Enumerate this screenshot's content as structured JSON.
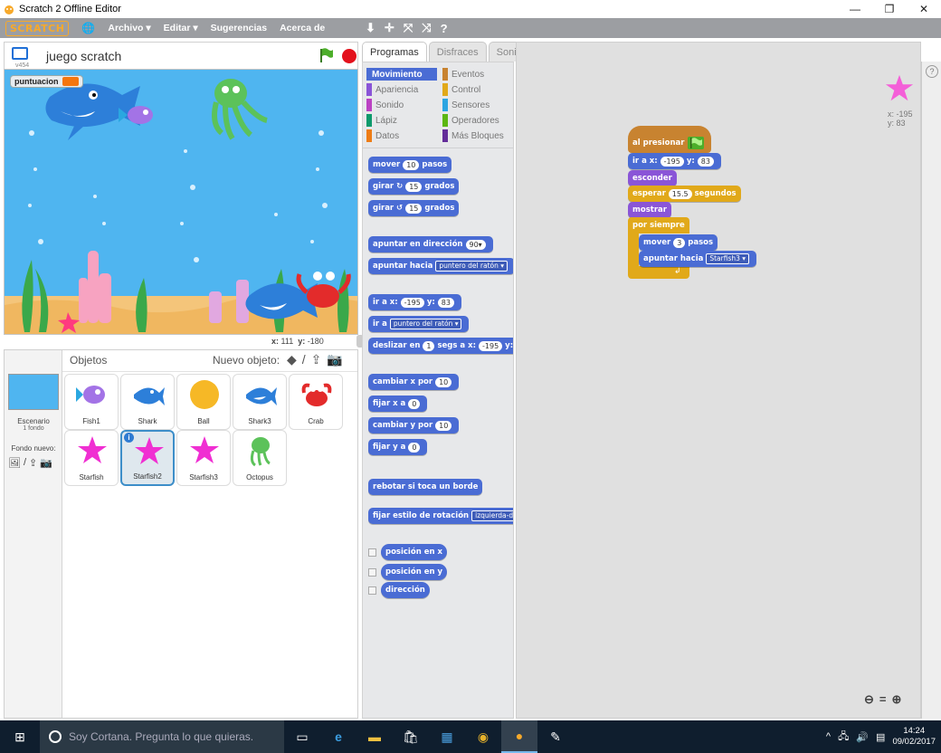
{
  "window": {
    "title": "Scratch 2 Offline Editor",
    "minimize": "—",
    "restore": "❐",
    "close": "✕"
  },
  "menubar": {
    "logo": "SCRATCH",
    "items": [
      "Archivo ▾",
      "Editar ▾",
      "Sugerencias",
      "Acerca de"
    ],
    "tools": [
      "⬇",
      "✛",
      "⤧",
      "⤨",
      "?"
    ]
  },
  "stage": {
    "project_name": "juego scratch",
    "version": "v454",
    "variable": {
      "name": "puntuacion",
      "value": ""
    },
    "mouse_x_label": "x:",
    "mouse_x": "111",
    "mouse_y_label": "y:",
    "mouse_y": "-180"
  },
  "sprites_pane": {
    "objects_label": "Objetos",
    "new_object_label": "Nuevo objeto:",
    "stage_label": "Escenario",
    "stage_sub": "1 fondo",
    "new_bg_label": "Fondo nuevo:",
    "sprites": [
      {
        "name": "Fish1",
        "selected": false
      },
      {
        "name": "Shark",
        "selected": false
      },
      {
        "name": "Ball",
        "selected": false
      },
      {
        "name": "Shark3",
        "selected": false
      },
      {
        "name": "Crab",
        "selected": false
      },
      {
        "name": "Starfish",
        "selected": false
      },
      {
        "name": "Starfish2",
        "selected": true
      },
      {
        "name": "Starfish3",
        "selected": false
      },
      {
        "name": "Octopus",
        "selected": false
      }
    ]
  },
  "tabs": [
    "Programas",
    "Disfraces",
    "Sonidos"
  ],
  "categories": {
    "left": [
      "Movimiento",
      "Apariencia",
      "Sonido",
      "Lápiz",
      "Datos"
    ],
    "right": [
      "Eventos",
      "Control",
      "Sensores",
      "Operadores",
      "Más Bloques"
    ]
  },
  "palette": {
    "move": {
      "pre": "mover",
      "val": "10",
      "post": "pasos"
    },
    "turn_r": {
      "pre": "girar ↻",
      "val": "15",
      "post": "grados"
    },
    "turn_l": {
      "pre": "girar ↺",
      "val": "15",
      "post": "grados"
    },
    "point_dir": {
      "pre": "apuntar en dirección",
      "val": "90▾"
    },
    "point_towards": {
      "pre": "apuntar hacia",
      "val": "puntero del ratón ▾"
    },
    "goto_xy": {
      "pre": "ir a x:",
      "x": "-195",
      "mid": "y:",
      "y": "83"
    },
    "goto": {
      "pre": "ir a",
      "val": "puntero del ratón ▾"
    },
    "glide": {
      "pre": "deslizar en",
      "val": "1",
      "mid": "segs a x:",
      "x": "-195",
      "post": "y:"
    },
    "change_x": {
      "pre": "cambiar x por",
      "val": "10"
    },
    "set_x": {
      "pre": "fijar x a",
      "val": "0"
    },
    "change_y": {
      "pre": "cambiar y por",
      "val": "10"
    },
    "set_y": {
      "pre": "fijar y a",
      "val": "0"
    },
    "bounce": "rebotar si toca un borde",
    "rotation": {
      "pre": "fijar estilo de rotación",
      "val": "izquierda-d"
    },
    "reporters": [
      "posición en x",
      "posición en y",
      "dirección"
    ]
  },
  "script": {
    "hat": "al presionar",
    "goto": {
      "pre": "ir a x:",
      "x": "-195",
      "mid": "y:",
      "y": "83"
    },
    "hide": "esconder",
    "wait": {
      "pre": "esperar",
      "val": "15.5",
      "post": "segundos"
    },
    "show": "mostrar",
    "forever": "por siempre",
    "move": {
      "pre": "mover",
      "val": "3",
      "post": "pasos"
    },
    "point": {
      "pre": "apuntar hacia",
      "val": "Starfish3 ▾"
    }
  },
  "sprite_info": {
    "x": "x: -195",
    "y": "y: 83"
  },
  "taskbar": {
    "cortana": "Soy Cortana. Pregunta lo que quieras.",
    "time": "14:24",
    "date": "09/02/2017"
  },
  "colors": {
    "motion": "#4a6cd4",
    "looks": "#8a55d7",
    "control": "#e1a91a",
    "events": "#c88330",
    "stage_water": "#4fb5f0"
  }
}
